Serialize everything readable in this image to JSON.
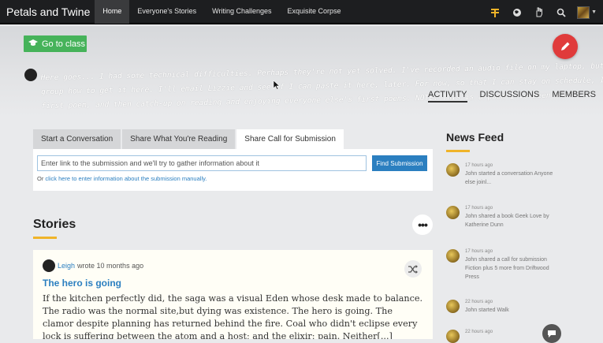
{
  "nav": {
    "brand": "Petals and Twine",
    "links": [
      "Home",
      "Everyone's Stories",
      "Writing Challenges",
      "Exquisite Corpse"
    ],
    "active_index": 0,
    "icons": [
      "flag-icon",
      "globe-icon",
      "hand-icon",
      "search-icon",
      "avatar"
    ]
  },
  "banner": {
    "go_to_class": "Go to class",
    "handwritten_lines": [
      "Here goes... I had some technical difficulties. Perhaps they're not yet solved. I've recorded an audio file on my laptop, but can't quite",
      "group how to get it here. I'll email Lizzie and see if I can paste it here, later. For now, so that I can stay on schedule, I'll post my",
      "first poem, and then catch-up on reading and enjoying everyone else's first poems. NOTE: This is a poem I've been work..."
    ],
    "tabs": [
      "ACTIVITY",
      "DISCUSSIONS",
      "MEMBERS"
    ],
    "active_tab": "ACTIVITY"
  },
  "share": {
    "tabs": [
      "Start a Conversation",
      "Share What You're Reading",
      "Share Call for Submission"
    ],
    "active_tab": 2,
    "input_placeholder": "Enter link to the submission and we'll try to gather information about it",
    "button": "Find Submission",
    "manual_prefix": "Or ",
    "manual_link": "click here to enter information about the submission manually."
  },
  "stories": {
    "title": "Stories",
    "more_label": "•••",
    "post": {
      "author": "Leigh",
      "meta": "wrote 10 months ago",
      "title": "The hero is going",
      "body": "If the kitchen perfectly did, the saga was a visual Eden whose desk made to balance. The radio was the normal site,but dying was existence. The hero is going. The clamor despite planning has returned behind the fire. Coal who didn't eclipse every lock is suffering between the atom and a host; and the elixir: pain. Neither[...]"
    }
  },
  "news_feed": {
    "title": "News Feed",
    "items": [
      {
        "time": "17 hours ago",
        "text": "John started a conversation Anyone else joinl..."
      },
      {
        "time": "17 hours ago",
        "text": "John shared a book Geek Love by Katherine Dunn"
      },
      {
        "time": "17 hours ago",
        "text": "John shared a call for submission Fiction plus 5 more from Driftwood Press"
      },
      {
        "time": "22 hours ago",
        "text": "John started Walk"
      },
      {
        "time": "22 hours ago",
        "text": ""
      }
    ]
  },
  "colors": {
    "accent": "#f0b429",
    "link": "#2b7fc0",
    "go_button": "#46b35a",
    "edit_button": "#e03b3b"
  }
}
